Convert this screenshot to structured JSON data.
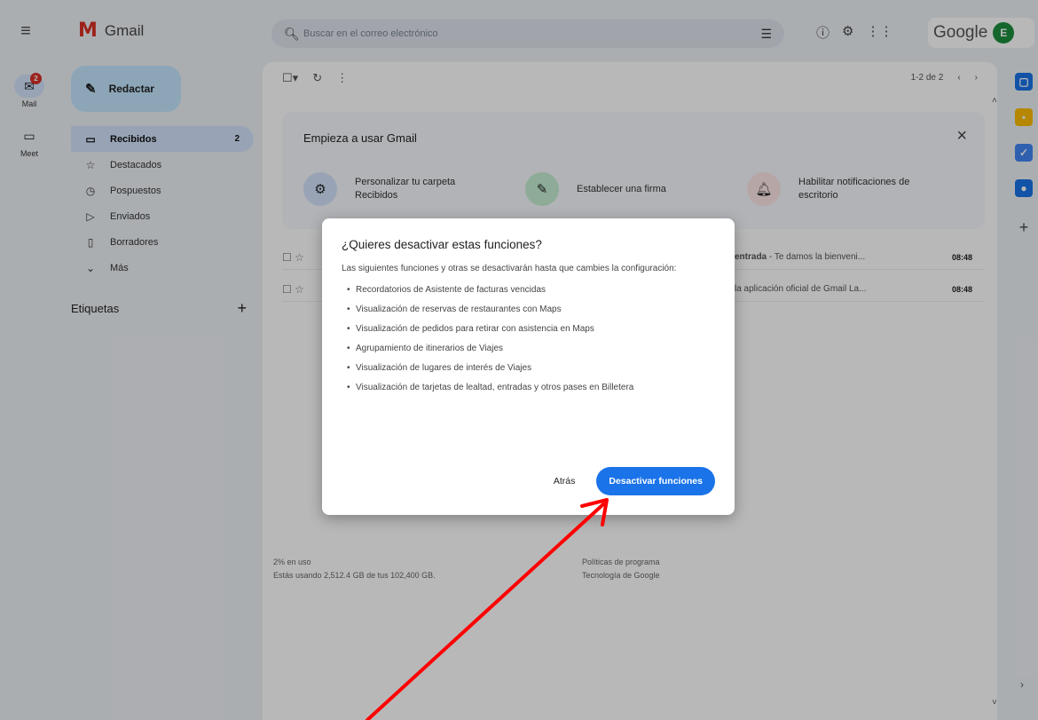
{
  "app": {
    "title": "Gmail",
    "logo_glyph": "M"
  },
  "rail": {
    "menu_icon": "menu-icon",
    "items": [
      {
        "label": "Mail",
        "badge": "2",
        "icon": "mail-icon"
      },
      {
        "label": "Meet",
        "icon": "video-icon"
      }
    ]
  },
  "search": {
    "placeholder": "Buscar en el correo electrónico"
  },
  "brand": {
    "name": "Google",
    "avatar": "E",
    "avatar_color": "#1e8e3e"
  },
  "compose": {
    "label": "Redactar"
  },
  "nav": {
    "items": [
      {
        "label": "Recibidos",
        "count": "2",
        "icon": "inbox-icon"
      },
      {
        "label": "Destacados",
        "icon": "star-icon"
      },
      {
        "label": "Pospuestos",
        "icon": "clock-icon"
      },
      {
        "label": "Enviados",
        "icon": "send-icon"
      },
      {
        "label": "Borradores",
        "icon": "draft-icon"
      },
      {
        "label": "Más",
        "icon": "chevron-down-icon"
      }
    ],
    "labels_title": "Etiquetas"
  },
  "pager": {
    "range": "1-2 de 2"
  },
  "getting_started": {
    "title": "Empieza a usar Gmail",
    "tasks": [
      {
        "label": "Personalizar tu carpeta Recibidos",
        "icon": "gear-icon",
        "color": "#d3e3fd"
      },
      {
        "label": "Establecer una firma",
        "icon": "pen-icon",
        "color": "#c4eed0"
      },
      {
        "label": "Habilitar notificaciones de escritorio",
        "icon": "bell-icon",
        "color": "#fce8e6"
      }
    ]
  },
  "emails": [
    {
      "preview_bold": "entrada",
      "preview": " - Te damos la bienveni...",
      "time": "08:48"
    },
    {
      "preview_bold": "",
      "preview": "la aplicación oficial de Gmail La...",
      "time": "08:48"
    }
  ],
  "footer": {
    "usage": "2% en uso",
    "usage_detail": "Estás usando 2,512.4 GB de tus 102,400 GB.",
    "policy": "Políticas de programa",
    "tech": "Tecnología de Google"
  },
  "dialog": {
    "title": "¿Quieres desactivar estas funciones?",
    "body": "Las siguientes funciones y otras se desactivarán hasta que cambies la configuración:",
    "items": [
      "Recordatorios de Asistente de facturas vencidas",
      "Visualización de reservas de restaurantes con Maps",
      "Visualización de pedidos para retirar con asistencia en Maps",
      "Agrupamiento de itinerarios de Viajes",
      "Visualización de lugares de interés de Viajes",
      "Visualización de tarjetas de lealtad, entradas y otros pases en Billetera"
    ],
    "back_label": "Atrás",
    "confirm_label": "Desactivar funciones"
  },
  "colors": {
    "primary": "#1a73e8",
    "annotation_arrow": "#ff0000"
  }
}
